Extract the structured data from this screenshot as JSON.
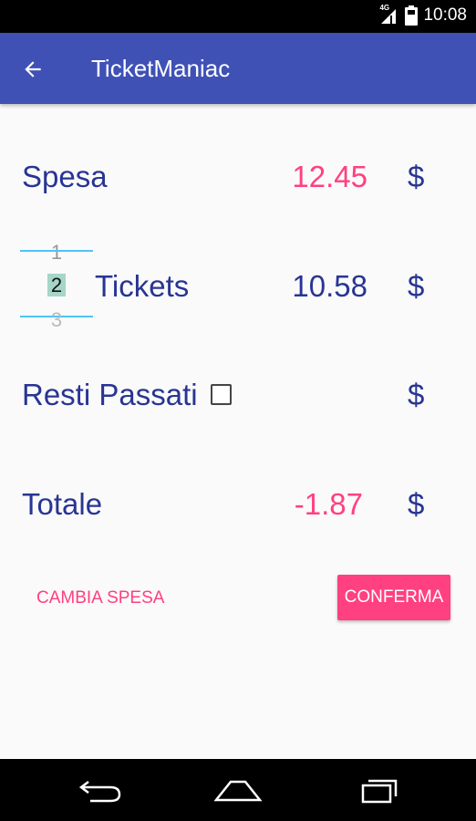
{
  "status_bar": {
    "time": "10:08",
    "network_label": "4G",
    "icons": [
      "signal-icon",
      "battery-icon"
    ]
  },
  "app_bar": {
    "title": "TicketManiac",
    "back_icon": "arrow-back-icon",
    "color": "#3f51b5"
  },
  "rows": {
    "spesa": {
      "label": "Spesa",
      "value": "12.45",
      "currency": "$"
    },
    "tickets": {
      "label": "Tickets",
      "value": "10.58",
      "currency": "$"
    },
    "resti": {
      "label": "Resti Passati",
      "currency": "$",
      "checked": false
    },
    "totale": {
      "label": "Totale",
      "value": "-1.87",
      "currency": "$"
    }
  },
  "ticket_picker": {
    "prev": "1",
    "current": "2",
    "next": "3"
  },
  "buttons": {
    "cambia": "CAMBIA SPESA",
    "conferma": "CONFERMA"
  },
  "colors": {
    "accent": "#ff4081",
    "primary_text": "#283593"
  },
  "nav_bar": {
    "icons": [
      "back-nav-icon",
      "home-nav-icon",
      "recents-nav-icon"
    ]
  }
}
